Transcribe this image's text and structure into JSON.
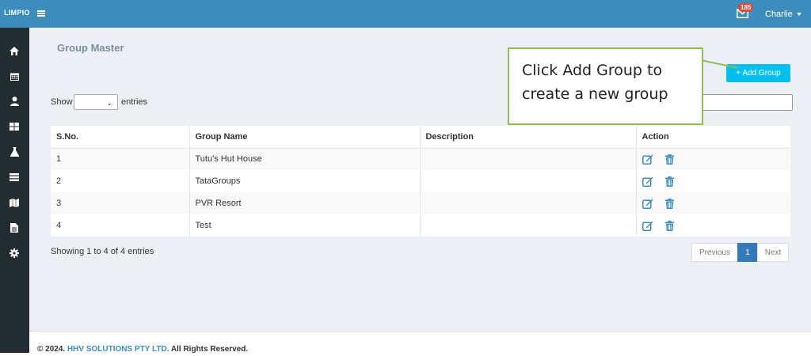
{
  "header": {
    "brand": "LIMPIO",
    "notification_count": "185",
    "user_name": "Charlie"
  },
  "sidebar": {
    "items": [
      {
        "icon": "home-icon"
      },
      {
        "icon": "calendar-icon"
      },
      {
        "icon": "user-icon"
      },
      {
        "icon": "dashboard-icon"
      },
      {
        "icon": "flask-icon"
      },
      {
        "icon": "server-icon"
      },
      {
        "icon": "map-icon"
      },
      {
        "icon": "file-icon"
      },
      {
        "icon": "gear-icon"
      }
    ]
  },
  "main": {
    "title": "Group Master",
    "add_button_label": "+ Add Group",
    "callout": {
      "line1": "Click Add Group to",
      "line2": "create a new group"
    },
    "show_label": "Show",
    "entries_label": "entries",
    "entries_value": "",
    "table": {
      "columns": [
        "S.No.",
        "Group Name",
        "Description",
        "Action"
      ],
      "rows": [
        {
          "sno": "1",
          "name": "Tutu's Hut House",
          "description": ""
        },
        {
          "sno": "2",
          "name": "TataGroups",
          "description": ""
        },
        {
          "sno": "3",
          "name": "PVR Resort",
          "description": ""
        },
        {
          "sno": "4",
          "name": "Test",
          "description": ""
        }
      ]
    },
    "info": "Showing 1 to 4 of 4 entries",
    "pagination": {
      "previous": "Previous",
      "current": "1",
      "next": "Next"
    }
  },
  "footer": {
    "prefix": "© 2024.",
    "company": "HHV SOLUTIONS PTY LTD.",
    "suffix": "All Rights Reserved."
  },
  "colors": {
    "topbar": "#3c8dbc",
    "sidebar": "#222d32",
    "add_button": "#00c0ef",
    "callout_border": "#8dbd57",
    "action_icon": "#3c8dbc"
  }
}
